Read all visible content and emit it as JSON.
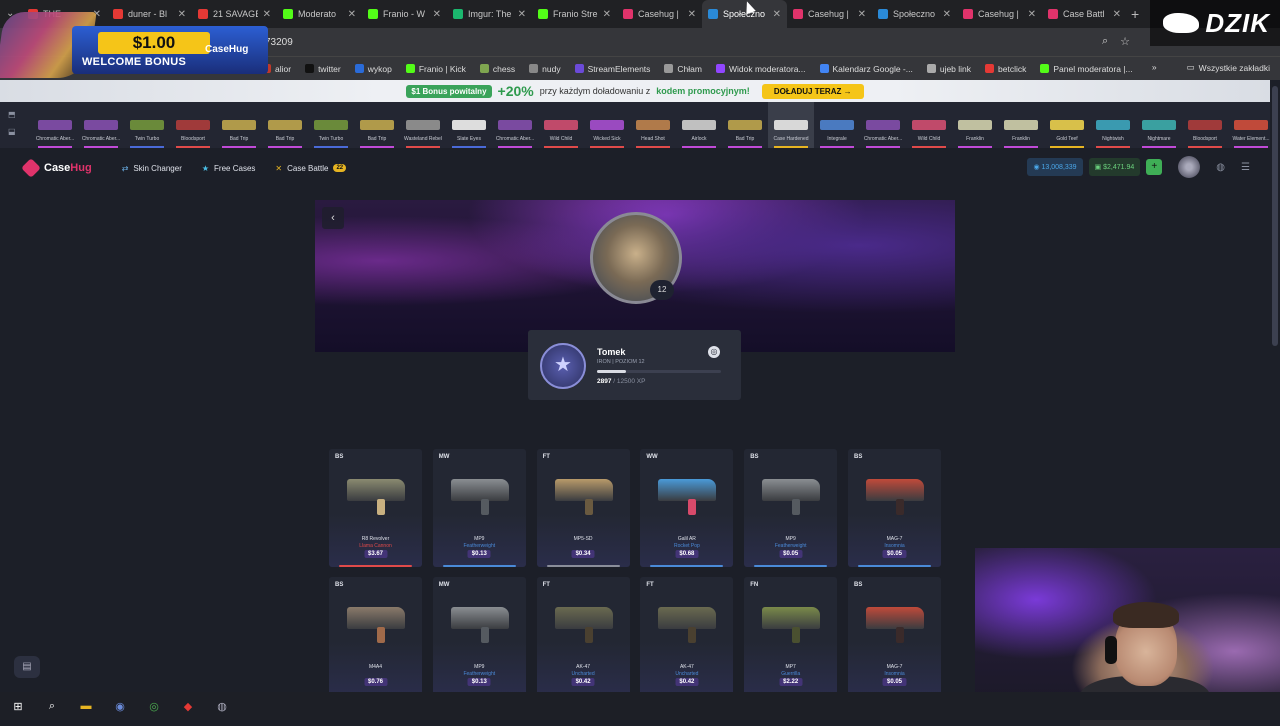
{
  "browser": {
    "tabs": [
      {
        "label": "THE",
        "color": "#e53935",
        "active": false
      },
      {
        "label": "duner - Bl",
        "color": "#e53935",
        "active": false
      },
      {
        "label": "21 SAVAGE",
        "color": "#e53935",
        "active": false
      },
      {
        "label": "Moderato",
        "color": "#53fc18",
        "active": false
      },
      {
        "label": "Franio - W",
        "color": "#53fc18",
        "active": false
      },
      {
        "label": "Imgur: The",
        "color": "#1bb76e",
        "active": false
      },
      {
        "label": "Franio Stre",
        "color": "#53fc18",
        "active": false
      },
      {
        "label": "Casehug |",
        "color": "#e0336b",
        "active": false
      },
      {
        "label": "Społeczno",
        "color": "#2a8ad8",
        "active": true
      },
      {
        "label": "Casehug |",
        "color": "#e0336b",
        "active": false
      },
      {
        "label": "Społeczno",
        "color": "#2a8ad8",
        "active": false
      },
      {
        "label": "Casehug |",
        "color": "#e0336b",
        "active": false
      },
      {
        "label": "Case Battl",
        "color": "#e0336b",
        "active": false
      }
    ],
    "address": "73209",
    "bookmarks": [
      {
        "label": "alior",
        "color": "#c0392b"
      },
      {
        "label": "twitter",
        "color": "#111111"
      },
      {
        "label": "wykop",
        "color": "#2a6bd8"
      },
      {
        "label": "Franio | Kick",
        "color": "#53fc18"
      },
      {
        "label": "chess",
        "color": "#7fa650"
      },
      {
        "label": "nudy",
        "color": "#888888"
      },
      {
        "label": "StreamElements",
        "color": "#6b4ad8"
      },
      {
        "label": "Chłam",
        "color": "#999999"
      },
      {
        "label": "Widok moderatora...",
        "color": "#9146ff"
      },
      {
        "label": "Kalendarz Google -...",
        "color": "#4285f4"
      },
      {
        "label": "ujeb link",
        "color": "#aaaaaa"
      },
      {
        "label": "betclick",
        "color": "#e53935"
      },
      {
        "label": "Panel moderatora |...",
        "color": "#53fc18"
      }
    ],
    "bookmarks_more": "»",
    "bookmarks_all": "Wszystkie zakładki"
  },
  "welcome": {
    "amount": "$1.00",
    "label": "WELCOME BONUS",
    "logo": "CaseHug"
  },
  "promo": {
    "pill": "$1 Bonus powitalny",
    "pct": "+20%",
    "text_a": "przy każdym doładowaniu z",
    "text_b": "kodem promocyjnym!",
    "cta": "DOŁADUJ TERAZ →"
  },
  "live_drops": [
    {
      "label": "Chromatic Aber...",
      "color": "#7a4aa0",
      "rarity": "#c04ad8"
    },
    {
      "label": "Chromatic Aber...",
      "color": "#7a4aa0",
      "rarity": "#c04ad8"
    },
    {
      "label": "Twin Turbo",
      "color": "#6a8a3a",
      "rarity": "#4a6ad8"
    },
    {
      "label": "Bloodsport",
      "color": "#a03a3a",
      "rarity": "#e04a4a"
    },
    {
      "label": "Bad Trip",
      "color": "#b09a4a",
      "rarity": "#c04ad8"
    },
    {
      "label": "Bad Trip",
      "color": "#b09a4a",
      "rarity": "#c04ad8"
    },
    {
      "label": "Twin Turbo",
      "color": "#6a8a3a",
      "rarity": "#4a6ad8"
    },
    {
      "label": "Bad Trip",
      "color": "#b09a4a",
      "rarity": "#c04ad8"
    },
    {
      "label": "Wasteland Rebel",
      "color": "#8a8a8a",
      "rarity": "#e04a4a"
    },
    {
      "label": "Slate Eyes",
      "color": "#dddddd",
      "rarity": "#4a6ad8"
    },
    {
      "label": "Chromatic Aber...",
      "color": "#7a4aa0",
      "rarity": "#c04ad8"
    },
    {
      "label": "Wild Child",
      "color": "#c04a6a",
      "rarity": "#e04a4a"
    },
    {
      "label": "Wicked Sick",
      "color": "#9a4ac0",
      "rarity": "#e04a4a"
    },
    {
      "label": "Head Shot",
      "color": "#b07a4a",
      "rarity": "#e04a4a"
    },
    {
      "label": "Airlock",
      "color": "#c0c0c0",
      "rarity": "#c04ad8"
    },
    {
      "label": "Bad Trip",
      "color": "#b09a4a",
      "rarity": "#c04ad8"
    },
    {
      "label": "Case Hardened",
      "color": "#d8d8d8",
      "rarity": "#e6b422"
    },
    {
      "label": "Integrale",
      "color": "#4a7ac0",
      "rarity": "#c04ad8"
    },
    {
      "label": "Chromatic Aber...",
      "color": "#7a4aa0",
      "rarity": "#c04ad8"
    },
    {
      "label": "Wild Child",
      "color": "#c04a6a",
      "rarity": "#e04a4a"
    },
    {
      "label": "Franklin",
      "color": "#c0c0a0",
      "rarity": "#c04ad8"
    },
    {
      "label": "Franklin",
      "color": "#c0c0a0",
      "rarity": "#c04ad8"
    },
    {
      "label": "Gold Teef",
      "color": "#d8c04a",
      "rarity": "#e6b422"
    },
    {
      "label": "Nightwish",
      "color": "#3a9ab0",
      "rarity": "#e04a4a"
    },
    {
      "label": "Nightmare",
      "color": "#3aa0a0",
      "rarity": "#c04ad8"
    },
    {
      "label": "Bloodsport",
      "color": "#a03a3a",
      "rarity": "#e04a4a"
    },
    {
      "label": "Water Element...",
      "color": "#c04a3a",
      "rarity": "#c04ad8"
    }
  ],
  "nav": {
    "logo_a": "Case",
    "logo_b": "Hug",
    "links": [
      {
        "label": "Skin Changer",
        "icon": "⇄"
      },
      {
        "label": "Free Cases",
        "icon": "★"
      },
      {
        "label": "Case Battle",
        "icon": "✕",
        "badge": "22"
      }
    ],
    "coins": "13,008,339",
    "balance": "$2,471.94",
    "plus": "+"
  },
  "profile": {
    "level": "12",
    "name": "Tomek",
    "rank": "IRON | POZIOM 12",
    "xp_current": "2897",
    "xp_total": "/ 12500 XP",
    "xp_fraction": 0.23
  },
  "items": [
    {
      "wear": "BS",
      "weapon": "R8 Revolver",
      "skin": "Llama Cannon",
      "price": "$3.67",
      "color": "#8a8a70",
      "rarity": "#e04a4a",
      "grip": "#c8b080"
    },
    {
      "wear": "MW",
      "weapon": "MP9",
      "skin": "Featherweight",
      "price": "$0.13",
      "color": "#8a8e92",
      "rarity": "#4a8ad8",
      "grip": "#555a60"
    },
    {
      "wear": "FT",
      "weapon": "MP5-SD",
      "skin": "",
      "price": "$0.34",
      "color": "#b89a6a",
      "rarity": "#8a8e9a",
      "grip": "#6a5a40"
    },
    {
      "wear": "WW",
      "weapon": "Galil AR",
      "skin": "Rocket Pop",
      "price": "$0.68",
      "color": "#4a9ad8",
      "rarity": "#4a8ad8",
      "grip": "#d84a6a"
    },
    {
      "wear": "BS",
      "weapon": "MP9",
      "skin": "Featherweight",
      "price": "$0.05",
      "color": "#8a8e92",
      "rarity": "#4a8ad8",
      "grip": "#555a60"
    },
    {
      "wear": "BS",
      "weapon": "MAG-7",
      "skin": "Insomnia",
      "price": "$0.05",
      "color": "#c04a3a",
      "rarity": "#4a8ad8",
      "grip": "#3a2a2a"
    },
    {
      "wear": "BS",
      "weapon": "M4A4",
      "skin": "",
      "price": "$0.76",
      "color": "#8a7a6a",
      "rarity": "#8a8e9a",
      "grip": "#a06a4a"
    },
    {
      "wear": "MW",
      "weapon": "MP9",
      "skin": "Featherweight",
      "price": "$0.13",
      "color": "#8a8e92",
      "rarity": "#4a8ad8",
      "grip": "#555a60"
    },
    {
      "wear": "FT",
      "weapon": "AK-47",
      "skin": "Uncharted",
      "price": "$0.42",
      "color": "#6a6a50",
      "rarity": "#4a8ad8",
      "grip": "#4a4030"
    },
    {
      "wear": "FT",
      "weapon": "AK-47",
      "skin": "Uncharted",
      "price": "$0.42",
      "color": "#6a6a50",
      "rarity": "#4a8ad8",
      "grip": "#4a4030"
    },
    {
      "wear": "FN",
      "weapon": "MP7",
      "skin": "Guerrilla",
      "price": "$2.22",
      "color": "#7a8a4a",
      "rarity": "#4a8ad8",
      "grip": "#4a5030"
    },
    {
      "wear": "BS",
      "weapon": "MAG-7",
      "skin": "Insomnia",
      "price": "$0.05",
      "color": "#c04a3a",
      "rarity": "#4a8ad8",
      "grip": "#3a2a2a"
    }
  ],
  "overlay": {
    "brand": "DZIK"
  },
  "taskbar": [
    {
      "name": "start-icon",
      "glyph": "⊞",
      "color": "#ffffff"
    },
    {
      "name": "search-icon",
      "glyph": "⌕",
      "color": "#ffffff"
    },
    {
      "name": "folder-icon",
      "glyph": "▬",
      "color": "#e6b422"
    },
    {
      "name": "app-icon",
      "glyph": "◉",
      "color": "#6a8ad8"
    },
    {
      "name": "chrome-icon",
      "glyph": "◎",
      "color": "#4caf50"
    },
    {
      "name": "app-red-icon",
      "glyph": "◆",
      "color": "#e53935"
    },
    {
      "name": "steam-icon",
      "glyph": "◍",
      "color": "#aab"
    }
  ]
}
